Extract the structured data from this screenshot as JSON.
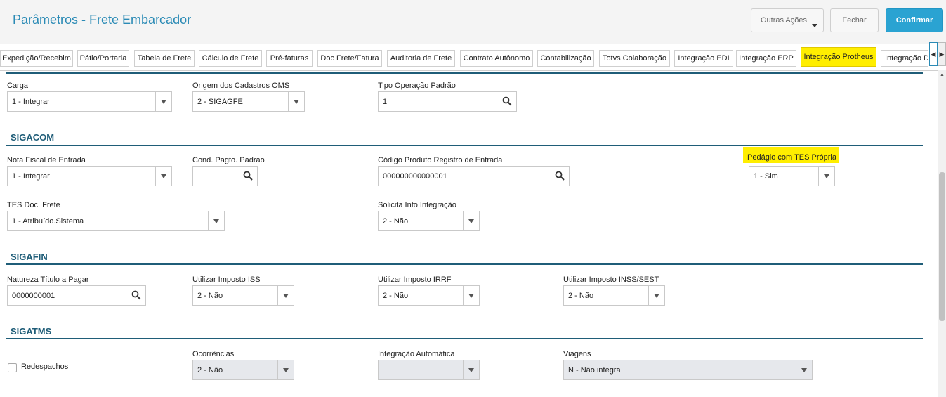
{
  "header": {
    "title": "Parâmetros - Frete Embarcador",
    "actions": [
      {
        "label": "Outras Ações"
      },
      {
        "label": "Fechar"
      },
      {
        "label": "Confirmar"
      }
    ]
  },
  "tabs": [
    {
      "label": "Expedição/Recebim"
    },
    {
      "label": "Pátio/Portaria"
    },
    {
      "label": "Tabela de Frete"
    },
    {
      "label": "Cálculo de Frete"
    },
    {
      "label": "Pré-faturas"
    },
    {
      "label": "Doc Frete/Fatura"
    },
    {
      "label": "Auditoria de Frete"
    },
    {
      "label": "Contrato Autônomo"
    },
    {
      "label": "Contabilização"
    },
    {
      "label": "Totvs Colaboração"
    },
    {
      "label": "Integração EDI"
    },
    {
      "label": "Integração ERP"
    },
    {
      "label": "Integração Protheus"
    },
    {
      "label": "Integração D"
    }
  ],
  "tab_nav": {
    "prev": "◀",
    "next": "▶"
  },
  "active_tab": "Integração Protheus",
  "colors": {
    "accent": "#2a8ab5",
    "primary_button": "#2aa3d2",
    "highlight": "#ffee00",
    "section": "#1f5d78"
  },
  "top": {
    "carga": {
      "label": "Carga",
      "value": "1 - Integrar"
    },
    "origem": {
      "label": "Origem dos Cadastros OMS",
      "value": "2 - SIGAGFE"
    },
    "tipo_operacao": {
      "label": "Tipo Operação Padrão",
      "value": "1"
    }
  },
  "sigacom": {
    "title": "SIGACOM",
    "nota_fiscal": {
      "label": "Nota Fiscal de Entrada",
      "value": "1 - Integrar"
    },
    "cond_pagto": {
      "label": "Cond. Pagto. Padrao",
      "value": ""
    },
    "codigo_produto": {
      "label": "Código Produto Registro de Entrada",
      "value": "000000000000001"
    },
    "pedagio": {
      "label": "Pedágio com TES Própria",
      "value": "1 - Sim"
    },
    "tes_doc": {
      "label": "TES Doc. Frete",
      "value": "1 - Atribuído.Sistema"
    },
    "solicita_info": {
      "label": "Solicita Info Integração",
      "value": "2 - Não"
    }
  },
  "sigafin": {
    "title": "SIGAFIN",
    "natureza": {
      "label": "Natureza Título a Pagar",
      "value": "0000000001"
    },
    "iss": {
      "label": "Utilizar Imposto ISS",
      "value": "2 - Não"
    },
    "irrf": {
      "label": "Utilizar Imposto IRRF",
      "value": "2 - Não"
    },
    "inss": {
      "label": "Utilizar Imposto INSS/SEST",
      "value": "2 - Não"
    }
  },
  "sigatms": {
    "title": "SIGATMS",
    "redespachos": {
      "label": "Redespachos",
      "checked": false
    },
    "ocorrencias": {
      "label": "Ocorrências",
      "value": "2 - Não"
    },
    "integracao_automatica": {
      "label": "Integração Automática",
      "value": ""
    },
    "viagens": {
      "label": "Viagens",
      "value": "N - Não integra"
    }
  }
}
